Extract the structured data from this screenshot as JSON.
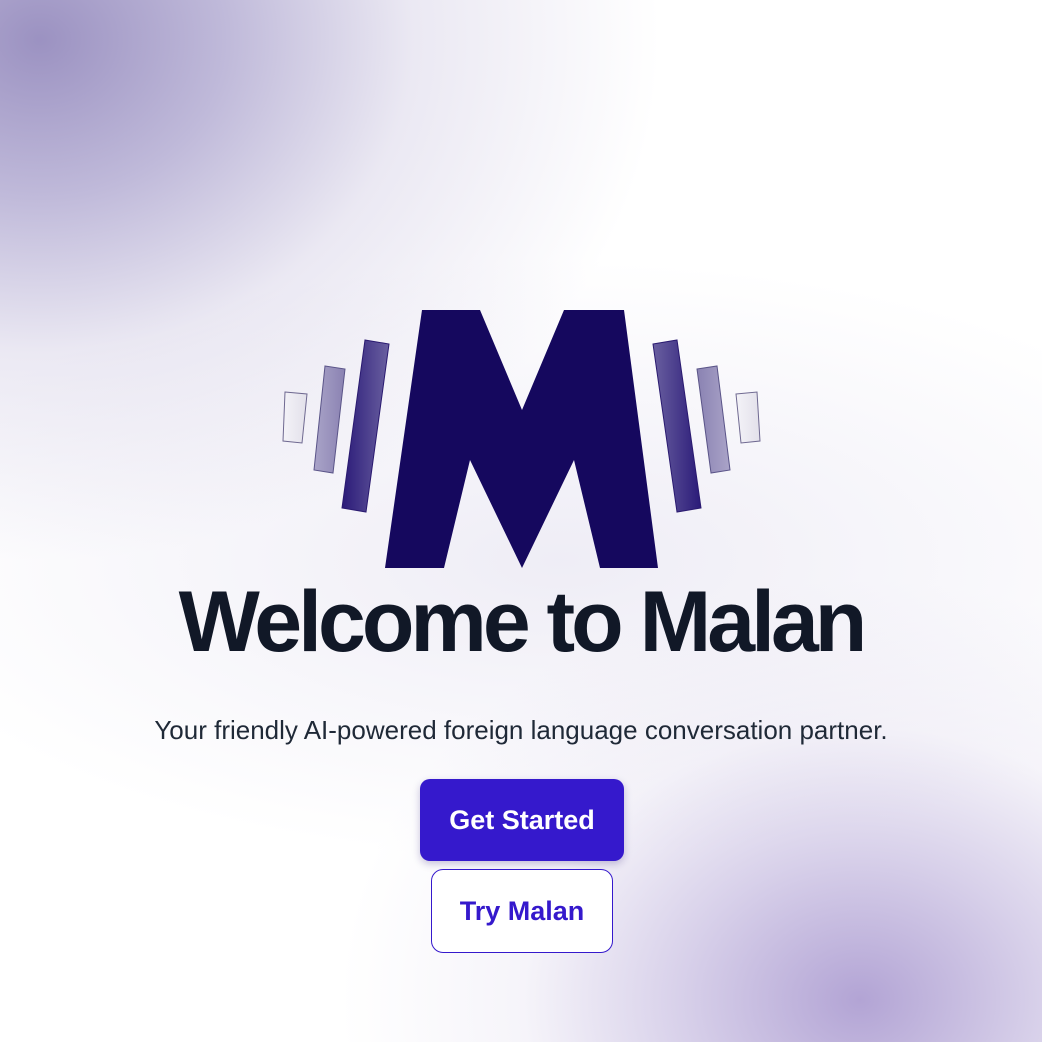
{
  "hero": {
    "title": "Welcome to Malan",
    "subtitle": "Your friendly AI-powered foreign language conversation partner.",
    "logo_icon": "malan-m-soundwave-logo"
  },
  "actions": {
    "primary_label": "Get Started",
    "secondary_label": "Try Malan"
  },
  "colors": {
    "brand_dark": "#15085e",
    "accent": "#3519cc",
    "title_text": "#111827",
    "body_text": "#1f2937"
  }
}
